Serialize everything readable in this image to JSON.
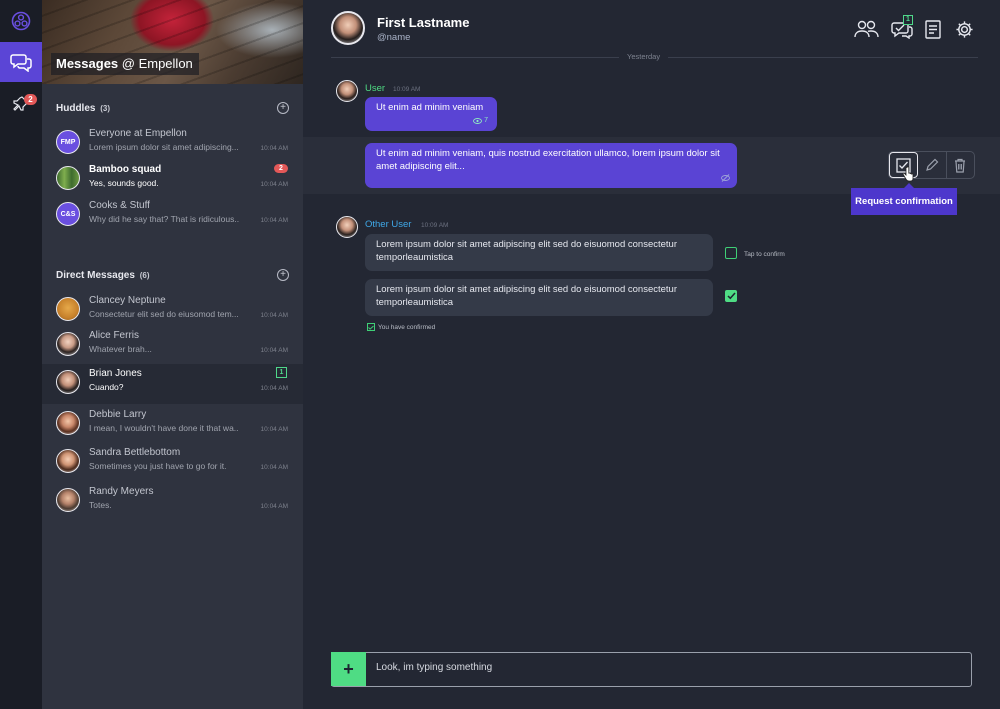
{
  "rail": {
    "pin_badge": "2"
  },
  "sidebar": {
    "banner_title_bold": "Messages",
    "banner_title_rest": " @ Empellon",
    "huddles": {
      "title": "Huddles",
      "count": "(3)",
      "items": [
        {
          "avatar_text": "FMP",
          "name": "Everyone at Empellon",
          "preview": "Lorem ipsum dolor sit amet adipiscing...",
          "time": "10:04 AM",
          "avatar_color": "#6a4fe0"
        },
        {
          "avatar_text": "",
          "name": "Bamboo squad",
          "preview": "Yes, sounds good.",
          "time": "10:04 AM",
          "badge": "2",
          "avatar_color": "#4c7a3a"
        },
        {
          "avatar_text": "C&S",
          "name": "Cooks & Stuff",
          "preview": "Why did he say that? That is ridiculous...",
          "time": "10:04 AM",
          "avatar_color": "#6a4fe0"
        }
      ]
    },
    "direct": {
      "title": "Direct Messages",
      "count": "(6)",
      "items": [
        {
          "name": "Clancey Neptune",
          "preview": "Consectetur elit sed do eiusomod tem...",
          "time": "10:04 AM"
        },
        {
          "name": "Alice Ferris",
          "preview": "Whatever brah...",
          "time": "10:04 AM"
        },
        {
          "name": "Brian Jones",
          "preview": "Cuando?",
          "time": "10:04 AM",
          "badge": "1"
        },
        {
          "name": "Debbie Larry",
          "preview": "I mean, I wouldn't have done it that wa...",
          "time": "10:04 AM"
        },
        {
          "name": "Sandra Bettlebottom",
          "preview": "Sometimes you just have to go for it.",
          "time": "10:04 AM"
        },
        {
          "name": "Randy Meyers",
          "preview": "Totes.",
          "time": "10:04 AM"
        }
      ]
    }
  },
  "header": {
    "name": "First Lastname",
    "handle": "@name",
    "confirm_badge": "1"
  },
  "chat": {
    "date_label": "Yesterday",
    "group1": {
      "user": "User",
      "time": "10:09 AM",
      "msg1": "Ut enim ad minim veniam",
      "msg1_views": "7",
      "msg2": "Ut enim ad minim veniam, quis nostrud exercitation ullamco, lorem ipsum dolor sit amet adipiscing elit..."
    },
    "tooltip": "Request confirmation",
    "group2": {
      "user": "Other User",
      "time": "10:09 AM",
      "msg1": "Lorem ipsum dolor sit amet adipiscing elit sed do eisuomod consectetur temporleaumistica",
      "tap_label": "Tap to confirm",
      "msg2": "Lorem ipsum dolor sit amet adipiscing elit sed do eisuomod consectetur temporleaumistica",
      "confirmed_label": "You have confirmed"
    }
  },
  "composer": {
    "value": "Look, im typing something",
    "add_label": "+"
  },
  "colors": {
    "accent": "#5a44d4",
    "green": "#4fdc84",
    "red": "#e35858"
  }
}
